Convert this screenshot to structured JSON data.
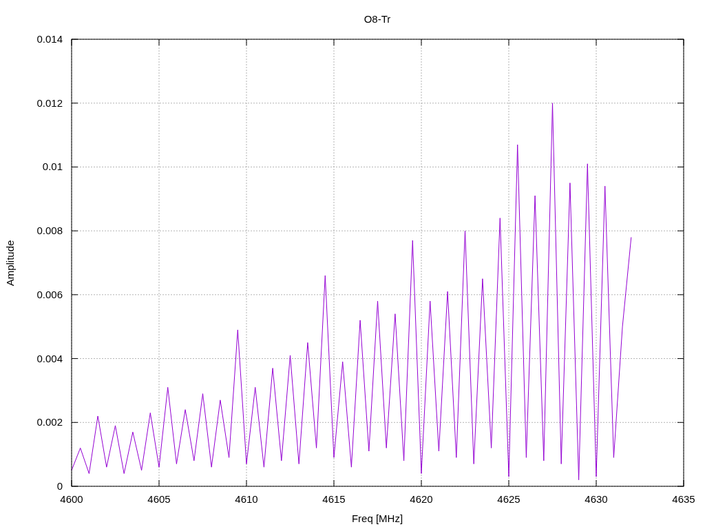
{
  "chart_data": {
    "type": "line",
    "title": "O8-Tr",
    "xlabel": "Freq [MHz]",
    "ylabel": "Amplitude",
    "grid": true,
    "xlim": [
      4600,
      4635
    ],
    "ylim": [
      0,
      0.014
    ],
    "xticks": [
      4600,
      4605,
      4610,
      4615,
      4620,
      4625,
      4630,
      4635
    ],
    "yticks": [
      {
        "value": 0,
        "label": "0"
      },
      {
        "value": 0.002,
        "label": "0.002"
      },
      {
        "value": 0.004,
        "label": "0.004"
      },
      {
        "value": 0.006,
        "label": "0.006"
      },
      {
        "value": 0.008,
        "label": "0.008"
      },
      {
        "value": 0.01,
        "label": "0.01"
      },
      {
        "value": 0.012,
        "label": "0.012"
      },
      {
        "value": 0.014,
        "label": "0.014"
      }
    ],
    "x": [
      4600,
      4600.5,
      4601,
      4601.5,
      4602,
      4602.5,
      4603,
      4603.5,
      4604,
      4604.5,
      4605,
      4605.5,
      4606,
      4606.5,
      4607,
      4607.5,
      4608,
      4608.5,
      4609,
      4609.5,
      4610,
      4610.5,
      4611,
      4611.5,
      4612,
      4612.5,
      4613,
      4613.5,
      4614,
      4614.5,
      4615,
      4615.5,
      4616,
      4616.5,
      4617,
      4617.5,
      4618,
      4618.5,
      4619,
      4619.5,
      4620,
      4620.5,
      4621,
      4621.5,
      4622,
      4622.5,
      4623,
      4623.5,
      4624,
      4624.5,
      4625,
      4625.5,
      4626,
      4626.5,
      4627,
      4627.5,
      4628,
      4628.5,
      4629,
      4629.5,
      4630,
      4630.5,
      4631,
      4631.5,
      4632
    ],
    "series": [
      {
        "color": "#9400d3",
        "values": [
          0.0005,
          0.0012,
          0.0004,
          0.0022,
          0.0006,
          0.0019,
          0.0004,
          0.0017,
          0.0005,
          0.0023,
          0.0006,
          0.0031,
          0.0007,
          0.0024,
          0.0008,
          0.0029,
          0.0006,
          0.0027,
          0.0009,
          0.0049,
          0.0007,
          0.0031,
          0.0006,
          0.0037,
          0.0008,
          0.0041,
          0.0007,
          0.0045,
          0.0012,
          0.0066,
          0.0009,
          0.0039,
          0.0006,
          0.0052,
          0.0011,
          0.0058,
          0.0012,
          0.0054,
          0.0008,
          0.0077,
          0.0004,
          0.0058,
          0.0011,
          0.0061,
          0.0009,
          0.008,
          0.0007,
          0.0065,
          0.0012,
          0.0084,
          0.0003,
          0.0107,
          0.0009,
          0.0091,
          0.0008,
          0.012,
          0.0007,
          0.0095,
          0.0002,
          0.0101,
          0.0003,
          0.0094,
          0.0009,
          0.005,
          0.0078
        ]
      }
    ]
  }
}
